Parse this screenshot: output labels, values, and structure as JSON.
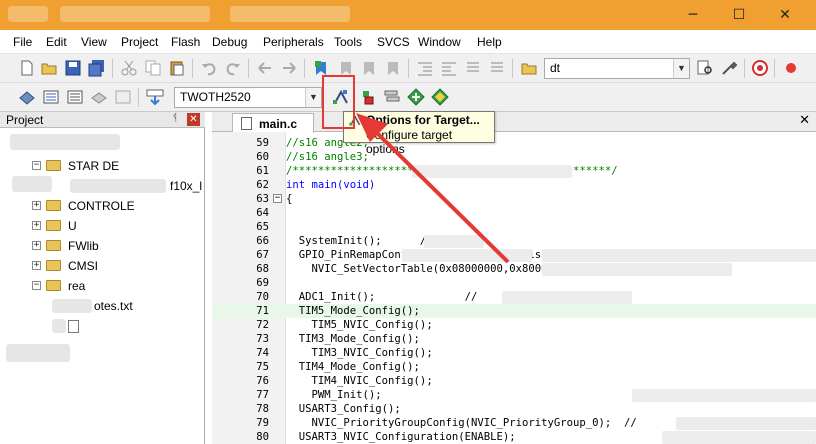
{
  "menubar": {
    "items": [
      "File",
      "Edit",
      "View",
      "Project",
      "Flash",
      "Debug",
      "Peripherals",
      "Tools",
      "SVCS",
      "Window",
      "Help"
    ]
  },
  "window_controls": {
    "minimize": "─",
    "maximize": "☐",
    "close": "✕"
  },
  "toolbar1": {
    "search_combo_value": "dt",
    "combo_arrow": "▼",
    "icons": [
      "new-file-icon",
      "open-file-icon",
      "save-icon",
      "save-all-icon",
      "cut-icon",
      "copy-icon",
      "paste-icon",
      "undo-icon",
      "redo-icon",
      "nav-back-icon",
      "nav-forward-icon",
      "bookmark-icon",
      "bookmark-prev-icon",
      "bookmark-next-icon",
      "bookmark-clear-icon",
      "indent-icon",
      "unindent-icon",
      "comment-icon",
      "uncomment-icon",
      "find-in-files-icon",
      "find-icon",
      "debug-start-icon",
      "record-icon"
    ]
  },
  "toolbar2": {
    "target_combo_value": "TWOTH2520",
    "combo_arrow": "▼",
    "icons": [
      "translate-icon",
      "build-icon",
      "rebuild-icon",
      "batch-build-icon",
      "stop-build-icon",
      "download-icon",
      "options-for-target-icon",
      "manage-project-items-icon",
      "select-packs-icon",
      "pack-installer-icon",
      "run-time-environment-icon"
    ]
  },
  "project_panel": {
    "title": "Project",
    "pin": "ᛩ",
    "close": "✕",
    "tree": [
      {
        "label": "STAR   DE",
        "expander": "−"
      },
      {
        "label": "f10x_l",
        "expander": ""
      },
      {
        "label": "CONTROLE",
        "expander": "+"
      },
      {
        "label": "U",
        "expander": "+"
      },
      {
        "label": "FWlib",
        "expander": "+"
      },
      {
        "label": "CMSI",
        "expander": "+"
      },
      {
        "label": "rea",
        "expander": "−"
      },
      {
        "label": "otes.txt",
        "expander": ""
      },
      {
        "label": "",
        "expander": ""
      }
    ]
  },
  "editor": {
    "tab_label": "main.c",
    "tab_close": "✕",
    "lines": [
      {
        "n": "59",
        "code": "//s16 angle2;",
        "type": "comment"
      },
      {
        "n": "60",
        "code": "//s16 angle3;",
        "type": "comment"
      },
      {
        "n": "61",
        "code": "/**************************************************/",
        "type": "comment"
      },
      {
        "n": "62",
        "code": "int main(void)",
        "type": "keyword"
      },
      {
        "n": "63",
        "code": "{",
        "type": "plain",
        "fold": "−"
      },
      {
        "n": "64",
        "code": "",
        "type": "plain"
      },
      {
        "n": "65",
        "code": "",
        "type": "plain"
      },
      {
        "n": "66",
        "code": "  SystemInit();      /",
        "type": "plain"
      },
      {
        "n": "67",
        "code": "  GPIO_PinRemapConfig(GPIO_Remap_SWJ_Disable,ENA",
        "type": "plain"
      },
      {
        "n": "68",
        "code": "    NVIC_SetVectorTable(0x08000000,0x8000); //",
        "type": "plain"
      },
      {
        "n": "69",
        "code": "",
        "type": "plain"
      },
      {
        "n": "70",
        "code": "  ADC1_Init();              //",
        "type": "plain"
      },
      {
        "n": "71",
        "code": "  TIM5_Mode_Config();",
        "type": "plain",
        "highlight": true
      },
      {
        "n": "72",
        "code": "    TIM5_NVIC_Config();",
        "type": "plain"
      },
      {
        "n": "73",
        "code": "  TIM3_Mode_Config();",
        "type": "plain"
      },
      {
        "n": "74",
        "code": "    TIM3_NVIC_Config();",
        "type": "plain"
      },
      {
        "n": "75",
        "code": "  TIM4_Mode_Config();",
        "type": "plain"
      },
      {
        "n": "76",
        "code": "    TIM4_NVIC_Config();",
        "type": "plain"
      },
      {
        "n": "77",
        "code": "    PWM_Init();",
        "type": "plain"
      },
      {
        "n": "78",
        "code": "  USART3_Config();",
        "type": "plain"
      },
      {
        "n": "79",
        "code": "    NVIC_PriorityGroupConfig(NVIC_PriorityGroup_0);  //",
        "type": "plain"
      },
      {
        "n": "80",
        "code": "  USART3_NVIC_Configuration(ENABLE);",
        "type": "plain"
      }
    ]
  },
  "tooltip": {
    "title": "Options for Target...",
    "description": "Configure target options"
  },
  "colors": {
    "titlebar": "#f0a030",
    "annotation_red": "#e53935",
    "comment_green": "#008000",
    "keyword_blue": "#0000ff"
  }
}
